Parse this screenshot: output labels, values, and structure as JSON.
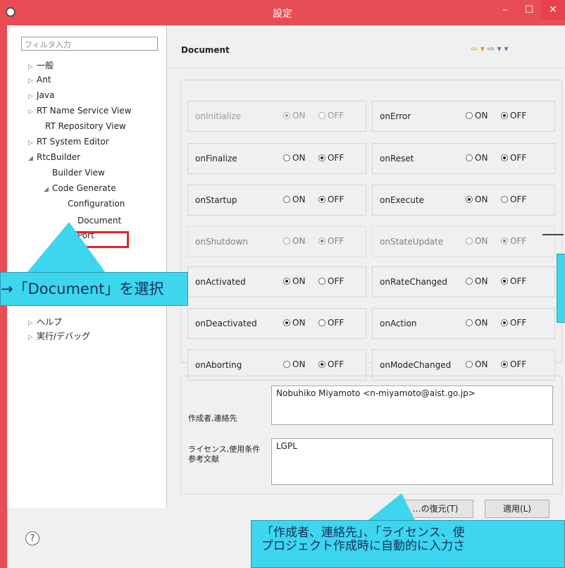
{
  "window": {
    "title": "設定"
  },
  "tree": {
    "filter_placeholder": "フィルタ入力",
    "items": [
      {
        "label": "一般",
        "expand": "▷"
      },
      {
        "label": "Ant",
        "expand": "▷"
      },
      {
        "label": "Java",
        "expand": "▷"
      },
      {
        "label": "RT Name Service View",
        "expand": "▷"
      },
      {
        "label": "RT Repository View",
        "expand": ""
      },
      {
        "label": "RT System Editor",
        "expand": "▷"
      },
      {
        "label": "RtcBuilder",
        "expand": "◢"
      },
      {
        "label": "Builder View",
        "expand": ""
      },
      {
        "label": "Code Generate",
        "expand": "◢"
      },
      {
        "label": "Configuration",
        "expand": ""
      },
      {
        "label": "Document",
        "expand": ""
      },
      {
        "label": "Port",
        "expand": ""
      },
      {
        "label": "ヘルプ",
        "expand": "▷"
      },
      {
        "label": "実行/デバッグ",
        "expand": "▷"
      }
    ]
  },
  "panel": {
    "title": "Document",
    "nav": {
      "back": "⇦ ▾",
      "forward": "⇨ ▾ ▾"
    }
  },
  "on_label": "ON",
  "off_label": "OFF",
  "callbacks": [
    {
      "name": "onInitialize",
      "value": "ON",
      "disabled": true
    },
    {
      "name": "onError",
      "value": "OFF"
    },
    {
      "name": "onFinalize",
      "value": "OFF"
    },
    {
      "name": "onReset",
      "value": "OFF"
    },
    {
      "name": "onStartup",
      "value": "OFF"
    },
    {
      "name": "onExecute",
      "value": "ON"
    },
    {
      "name": "onShutdown",
      "value": "OFF"
    },
    {
      "name": "onStateUpdate",
      "value": "OFF"
    },
    {
      "name": "onActivated",
      "value": "ON"
    },
    {
      "name": "onRateChanged",
      "value": "OFF"
    },
    {
      "name": "onDeactivated",
      "value": "ON"
    },
    {
      "name": "onAction",
      "value": "OFF"
    },
    {
      "name": "onAborting",
      "value": "OFF"
    },
    {
      "name": "onModeChanged",
      "value": "OFF"
    }
  ],
  "doc": {
    "author_label": "作成者,連絡先",
    "author_value": "Nobuhiko Miyamoto <n-miyamoto@aist.go.jp>",
    "license_label_1": "ライセンス,使用条件",
    "license_label_2": "参考文献",
    "license_value": "LGPL"
  },
  "buttons": {
    "restore": "…の復元(T)",
    "apply": "適用(L)"
  },
  "help_icon": "?",
  "annotations": {
    "select_document": "→「Document」を選択",
    "bottom_line_1": "「作成者、連絡先」、「ライセンス、使",
    "bottom_line_2": "プロジェクト作成時に自動的に入力さ"
  }
}
